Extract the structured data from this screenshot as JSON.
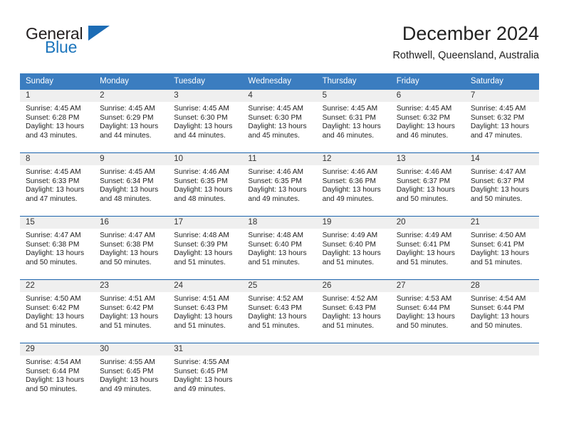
{
  "logo": {
    "word_one": "General",
    "word_two": "Blue",
    "triangle": "triangle-mark"
  },
  "header": {
    "title": "December 2024",
    "location": "Rothwell, Queensland, Australia"
  },
  "weekday_headers": [
    "Sunday",
    "Monday",
    "Tuesday",
    "Wednesday",
    "Thursday",
    "Friday",
    "Saturday"
  ],
  "colors": {
    "header_blue": "#3b7dc0",
    "row_divider_blue": "#1c64ad",
    "daynum_background": "#efefef",
    "logo_blue": "#1c75bc",
    "text": "#222222"
  },
  "weeks": [
    [
      {
        "day": "1",
        "sunrise": "Sunrise: 4:45 AM",
        "sunset": "Sunset: 6:28 PM",
        "daylight_line1": "Daylight: 13 hours",
        "daylight_line2": "and 43 minutes."
      },
      {
        "day": "2",
        "sunrise": "Sunrise: 4:45 AM",
        "sunset": "Sunset: 6:29 PM",
        "daylight_line1": "Daylight: 13 hours",
        "daylight_line2": "and 44 minutes."
      },
      {
        "day": "3",
        "sunrise": "Sunrise: 4:45 AM",
        "sunset": "Sunset: 6:30 PM",
        "daylight_line1": "Daylight: 13 hours",
        "daylight_line2": "and 44 minutes."
      },
      {
        "day": "4",
        "sunrise": "Sunrise: 4:45 AM",
        "sunset": "Sunset: 6:30 PM",
        "daylight_line1": "Daylight: 13 hours",
        "daylight_line2": "and 45 minutes."
      },
      {
        "day": "5",
        "sunrise": "Sunrise: 4:45 AM",
        "sunset": "Sunset: 6:31 PM",
        "daylight_line1": "Daylight: 13 hours",
        "daylight_line2": "and 46 minutes."
      },
      {
        "day": "6",
        "sunrise": "Sunrise: 4:45 AM",
        "sunset": "Sunset: 6:32 PM",
        "daylight_line1": "Daylight: 13 hours",
        "daylight_line2": "and 46 minutes."
      },
      {
        "day": "7",
        "sunrise": "Sunrise: 4:45 AM",
        "sunset": "Sunset: 6:32 PM",
        "daylight_line1": "Daylight: 13 hours",
        "daylight_line2": "and 47 minutes."
      }
    ],
    [
      {
        "day": "8",
        "sunrise": "Sunrise: 4:45 AM",
        "sunset": "Sunset: 6:33 PM",
        "daylight_line1": "Daylight: 13 hours",
        "daylight_line2": "and 47 minutes."
      },
      {
        "day": "9",
        "sunrise": "Sunrise: 4:45 AM",
        "sunset": "Sunset: 6:34 PM",
        "daylight_line1": "Daylight: 13 hours",
        "daylight_line2": "and 48 minutes."
      },
      {
        "day": "10",
        "sunrise": "Sunrise: 4:46 AM",
        "sunset": "Sunset: 6:35 PM",
        "daylight_line1": "Daylight: 13 hours",
        "daylight_line2": "and 48 minutes."
      },
      {
        "day": "11",
        "sunrise": "Sunrise: 4:46 AM",
        "sunset": "Sunset: 6:35 PM",
        "daylight_line1": "Daylight: 13 hours",
        "daylight_line2": "and 49 minutes."
      },
      {
        "day": "12",
        "sunrise": "Sunrise: 4:46 AM",
        "sunset": "Sunset: 6:36 PM",
        "daylight_line1": "Daylight: 13 hours",
        "daylight_line2": "and 49 minutes."
      },
      {
        "day": "13",
        "sunrise": "Sunrise: 4:46 AM",
        "sunset": "Sunset: 6:37 PM",
        "daylight_line1": "Daylight: 13 hours",
        "daylight_line2": "and 50 minutes."
      },
      {
        "day": "14",
        "sunrise": "Sunrise: 4:47 AM",
        "sunset": "Sunset: 6:37 PM",
        "daylight_line1": "Daylight: 13 hours",
        "daylight_line2": "and 50 minutes."
      }
    ],
    [
      {
        "day": "15",
        "sunrise": "Sunrise: 4:47 AM",
        "sunset": "Sunset: 6:38 PM",
        "daylight_line1": "Daylight: 13 hours",
        "daylight_line2": "and 50 minutes."
      },
      {
        "day": "16",
        "sunrise": "Sunrise: 4:47 AM",
        "sunset": "Sunset: 6:38 PM",
        "daylight_line1": "Daylight: 13 hours",
        "daylight_line2": "and 50 minutes."
      },
      {
        "day": "17",
        "sunrise": "Sunrise: 4:48 AM",
        "sunset": "Sunset: 6:39 PM",
        "daylight_line1": "Daylight: 13 hours",
        "daylight_line2": "and 51 minutes."
      },
      {
        "day": "18",
        "sunrise": "Sunrise: 4:48 AM",
        "sunset": "Sunset: 6:40 PM",
        "daylight_line1": "Daylight: 13 hours",
        "daylight_line2": "and 51 minutes."
      },
      {
        "day": "19",
        "sunrise": "Sunrise: 4:49 AM",
        "sunset": "Sunset: 6:40 PM",
        "daylight_line1": "Daylight: 13 hours",
        "daylight_line2": "and 51 minutes."
      },
      {
        "day": "20",
        "sunrise": "Sunrise: 4:49 AM",
        "sunset": "Sunset: 6:41 PM",
        "daylight_line1": "Daylight: 13 hours",
        "daylight_line2": "and 51 minutes."
      },
      {
        "day": "21",
        "sunrise": "Sunrise: 4:50 AM",
        "sunset": "Sunset: 6:41 PM",
        "daylight_line1": "Daylight: 13 hours",
        "daylight_line2": "and 51 minutes."
      }
    ],
    [
      {
        "day": "22",
        "sunrise": "Sunrise: 4:50 AM",
        "sunset": "Sunset: 6:42 PM",
        "daylight_line1": "Daylight: 13 hours",
        "daylight_line2": "and 51 minutes."
      },
      {
        "day": "23",
        "sunrise": "Sunrise: 4:51 AM",
        "sunset": "Sunset: 6:42 PM",
        "daylight_line1": "Daylight: 13 hours",
        "daylight_line2": "and 51 minutes."
      },
      {
        "day": "24",
        "sunrise": "Sunrise: 4:51 AM",
        "sunset": "Sunset: 6:43 PM",
        "daylight_line1": "Daylight: 13 hours",
        "daylight_line2": "and 51 minutes."
      },
      {
        "day": "25",
        "sunrise": "Sunrise: 4:52 AM",
        "sunset": "Sunset: 6:43 PM",
        "daylight_line1": "Daylight: 13 hours",
        "daylight_line2": "and 51 minutes."
      },
      {
        "day": "26",
        "sunrise": "Sunrise: 4:52 AM",
        "sunset": "Sunset: 6:43 PM",
        "daylight_line1": "Daylight: 13 hours",
        "daylight_line2": "and 51 minutes."
      },
      {
        "day": "27",
        "sunrise": "Sunrise: 4:53 AM",
        "sunset": "Sunset: 6:44 PM",
        "daylight_line1": "Daylight: 13 hours",
        "daylight_line2": "and 50 minutes."
      },
      {
        "day": "28",
        "sunrise": "Sunrise: 4:54 AM",
        "sunset": "Sunset: 6:44 PM",
        "daylight_line1": "Daylight: 13 hours",
        "daylight_line2": "and 50 minutes."
      }
    ],
    [
      {
        "day": "29",
        "sunrise": "Sunrise: 4:54 AM",
        "sunset": "Sunset: 6:44 PM",
        "daylight_line1": "Daylight: 13 hours",
        "daylight_line2": "and 50 minutes."
      },
      {
        "day": "30",
        "sunrise": "Sunrise: 4:55 AM",
        "sunset": "Sunset: 6:45 PM",
        "daylight_line1": "Daylight: 13 hours",
        "daylight_line2": "and 49 minutes."
      },
      {
        "day": "31",
        "sunrise": "Sunrise: 4:55 AM",
        "sunset": "Sunset: 6:45 PM",
        "daylight_line1": "Daylight: 13 hours",
        "daylight_line2": "and 49 minutes."
      },
      {
        "day": "",
        "sunrise": "",
        "sunset": "",
        "daylight_line1": "",
        "daylight_line2": ""
      },
      {
        "day": "",
        "sunrise": "",
        "sunset": "",
        "daylight_line1": "",
        "daylight_line2": ""
      },
      {
        "day": "",
        "sunrise": "",
        "sunset": "",
        "daylight_line1": "",
        "daylight_line2": ""
      },
      {
        "day": "",
        "sunrise": "",
        "sunset": "",
        "daylight_line1": "",
        "daylight_line2": ""
      }
    ]
  ]
}
